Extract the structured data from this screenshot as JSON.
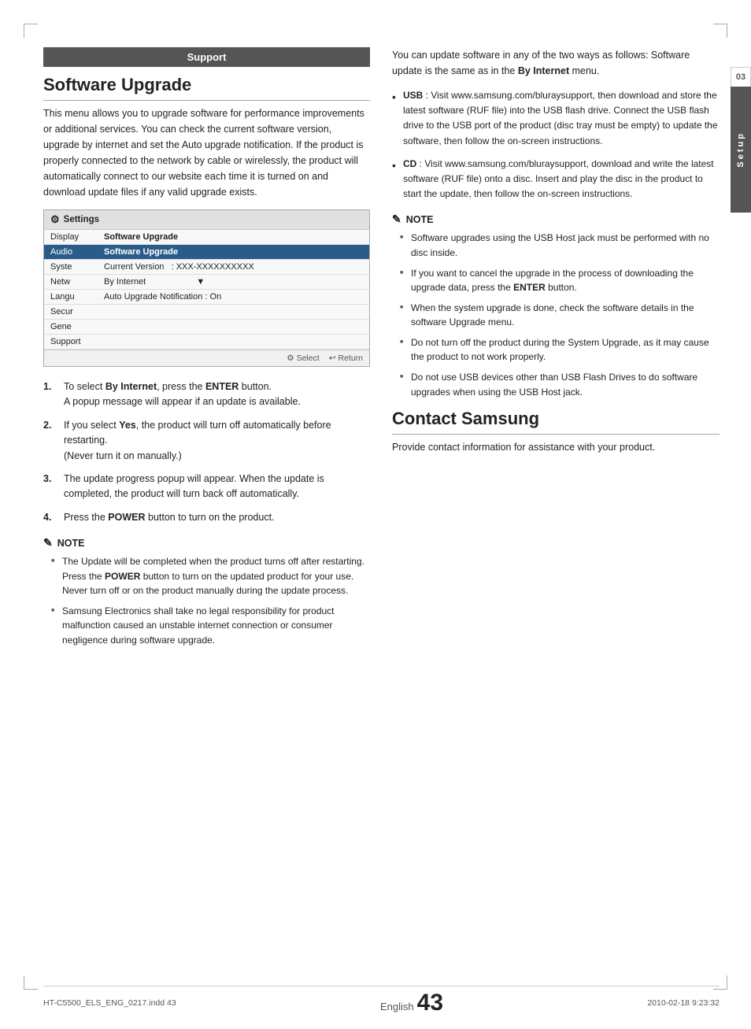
{
  "page": {
    "title": "Support Software Upgrade",
    "page_number": "43",
    "language": "English"
  },
  "sidebar": {
    "number": "03",
    "label": "Setup"
  },
  "left": {
    "support_header": "Support",
    "section_title": "Software Upgrade",
    "body_text": "This menu allows you to upgrade software for performance improvements or additional services. You can check the current software version, upgrade by internet and set the Auto upgrade notification. If the product is properly connected to the network by cable or wirelessly, the product will automatically connect to our website each time it is turned on and download update files if any valid upgrade exists.",
    "settings_box": {
      "title": "Settings",
      "rows": [
        {
          "label": "Display",
          "value": "Software Upgrade",
          "highlighted": false
        },
        {
          "label": "Audio",
          "value": "Software Upgrade",
          "highlighted": true
        },
        {
          "label": "Syste",
          "value": "Current Version    : XXX-XXXXXXXXXX",
          "highlighted": false
        },
        {
          "label": "Netw",
          "value": "By Internet",
          "highlighted": false,
          "arrow": "▼"
        },
        {
          "label": "Langu",
          "value": "Auto Upgrade Notification  : On",
          "highlighted": false
        },
        {
          "label": "Secur",
          "value": "",
          "highlighted": false
        },
        {
          "label": "Gene",
          "value": "",
          "highlighted": false
        },
        {
          "label": "Support",
          "value": "",
          "highlighted": false
        }
      ],
      "footer_select": "⚙ Select",
      "footer_return": "↩ Return"
    },
    "steps": [
      {
        "num": "1.",
        "text_before": "To select ",
        "bold": "By Internet",
        "text_mid": ", press the ",
        "bold2": "ENTER",
        "text_after": " button.\nA popup message will appear if an update is available."
      },
      {
        "num": "2.",
        "text_before": "If you select ",
        "bold": "Yes",
        "text_after": ", the product will turn off automatically before restarting.\n(Never turn it on manually.)"
      },
      {
        "num": "3.",
        "text": "The update progress popup will appear. When the update is completed, the product will turn back off automatically."
      },
      {
        "num": "4.",
        "text_before": "Press the ",
        "bold": "POWER",
        "text_after": " button to turn on the product."
      }
    ],
    "note_header": "NOTE",
    "notes": [
      "The Update will be completed when the product turns off after restarting. Press the POWER button to turn on the updated product for your use.\nNever turn off or on the product manually during the update process.",
      "Samsung Electronics shall take no legal responsibility for product malfunction caused an unstable internet connection or consumer negligence during software upgrade."
    ]
  },
  "right": {
    "intro": "You can update software in any of the two ways as follows: Software update is the same as in the By Internet menu.",
    "bullets": [
      {
        "key": "USB",
        "text": " : Visit www.samsung.com/bluraysupport, then download and store the latest software (RUF file) into the USB flash drive. Connect the USB flash drive to the USB port of the product (disc tray must be empty) to update the software, then follow the on-screen instructions."
      },
      {
        "key": "CD",
        "text": " : Visit www.samsung.com/bluraysupport, download and write the latest software (RUF file) onto a disc. Insert and play the disc in the product to start the update, then follow the on-screen instructions."
      }
    ],
    "note_header": "NOTE",
    "notes": [
      "Software upgrades using the USB Host jack must be performed with no disc inside.",
      "If you want to cancel the upgrade in the process of downloading the upgrade data, press the ENTER button.",
      "When the system upgrade is done, check the software details in the software Upgrade menu.",
      "Do not turn off the product during the System Upgrade, as it may cause the product to not work properly.",
      "Do not use USB devices other than USB Flash Drives to do software upgrades when using the USB Host jack."
    ],
    "contact_title": "Contact Samsung",
    "contact_text": "Provide contact information for assistance with your product."
  },
  "footer": {
    "left_text": "HT-C5500_ELS_ENG_0217.indd   43",
    "right_text": "2010-02-18   9:23:32",
    "english_label": "English",
    "page_num": "43"
  }
}
